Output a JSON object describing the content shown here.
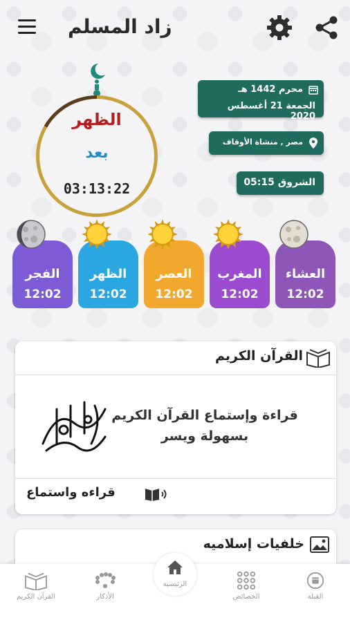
{
  "app": {
    "title": "زاد المسلم"
  },
  "clock": {
    "prayer": "الظهر",
    "label": "بعد",
    "remaining": "03:13:22"
  },
  "info": {
    "hijri": "محرم 1442 هـ",
    "gregorian": "الجمعة 21 أغسطس 2020",
    "location": "مصر , منشاة الأوقاف",
    "sunrise": "الشروق 05:15"
  },
  "prayers": [
    {
      "name": "الفجر",
      "time": "12:02",
      "color": "#7e5bd6",
      "icon": "moon-icon"
    },
    {
      "name": "الظهر",
      "time": "12:02",
      "color": "#2aa6e0",
      "icon": "sun-icon"
    },
    {
      "name": "العصر",
      "time": "12:02",
      "color": "#f2a82c",
      "icon": "sun-icon"
    },
    {
      "name": "المغرب",
      "time": "12:02",
      "color": "#9b4bcf",
      "icon": "sun-icon"
    },
    {
      "name": "العشاء",
      "time": "12:02",
      "color": "#8e56b8",
      "icon": "moon-icon"
    }
  ],
  "quran_card": {
    "title": "القرآن الكريم",
    "desc_line1": "قراءة وإستماع القرآن الكريم",
    "desc_line2": "بسهولة ويسر",
    "action": "قراءه واستماع"
  },
  "wallpapers_card": {
    "title": "خلفيات إسلاميه"
  },
  "nav": {
    "quran": "القرآن الكريم",
    "azkar": "الأذكار",
    "home": "الرئيسية",
    "features": "الخصائص",
    "qibla": "القبلة"
  }
}
